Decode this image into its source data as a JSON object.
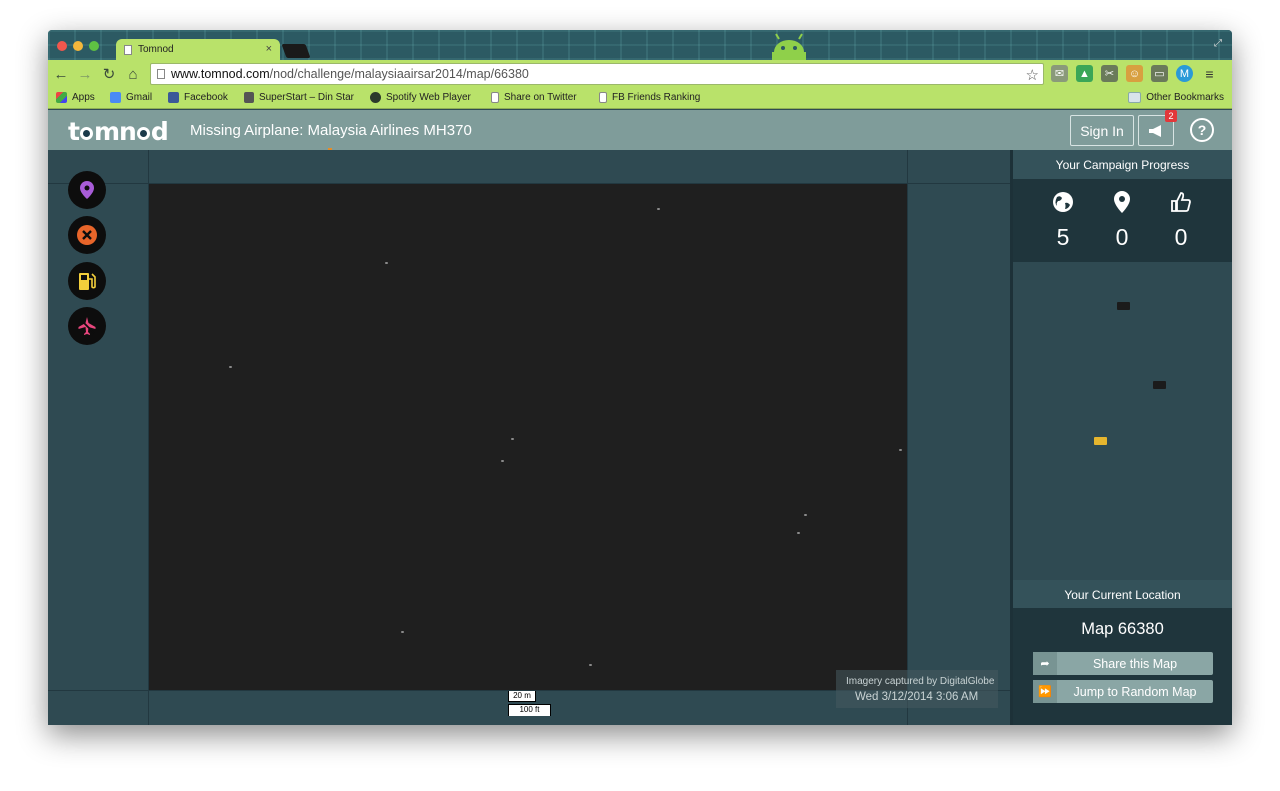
{
  "browser": {
    "tab_title": "Tomnod",
    "tab_close": "×",
    "url_host": "www.tomnod.com",
    "url_path": "/nod/challenge/malaysiaairsar2014/map/66380",
    "bookmarks": [
      "Apps",
      "Gmail",
      "Facebook",
      "SuperStart – Din Star",
      "Spotify Web Player",
      "Share on Twitter",
      "FB Friends Ranking"
    ],
    "other_bookmarks": "Other Bookmarks"
  },
  "app": {
    "logo_left": "t",
    "logo_mid": "mn",
    "logo_right": "d",
    "title": "Missing Airplane: Malaysia Airlines MH370",
    "signin_label": "Sign In",
    "notification_count": "2",
    "help_label": "?"
  },
  "tools": [
    {
      "name": "pin-tool",
      "color": "#a85cd8"
    },
    {
      "name": "damage-tool",
      "color": "#e8652a"
    },
    {
      "name": "fuel-tool",
      "color": "#f3cf3b"
    },
    {
      "name": "airplane-tool",
      "color": "#e8467d"
    }
  ],
  "map": {
    "attribution": "Imagery captured by DigitalGlobe",
    "capture_date": "Wed 3/12/2014 3:06 AM",
    "scale_m": "20 m",
    "scale_ft": "100 ft"
  },
  "sidebar": {
    "progress_title": "Your Campaign Progress",
    "stats": [
      {
        "icon": "globe-icon",
        "value": "5"
      },
      {
        "icon": "map-pin-icon",
        "value": "0"
      },
      {
        "icon": "thumbs-up-icon",
        "value": "0"
      }
    ],
    "location_title": "Your Current Location",
    "map_id": "Map 66380",
    "share_label": "Share this Map",
    "random_label": "Jump to Random Map"
  },
  "colors": {
    "chrome_green": "#b9e26a",
    "header_gray": "#7f9c9a",
    "panel_dark": "#1f353c",
    "minimap_current": "#e6b62e"
  }
}
